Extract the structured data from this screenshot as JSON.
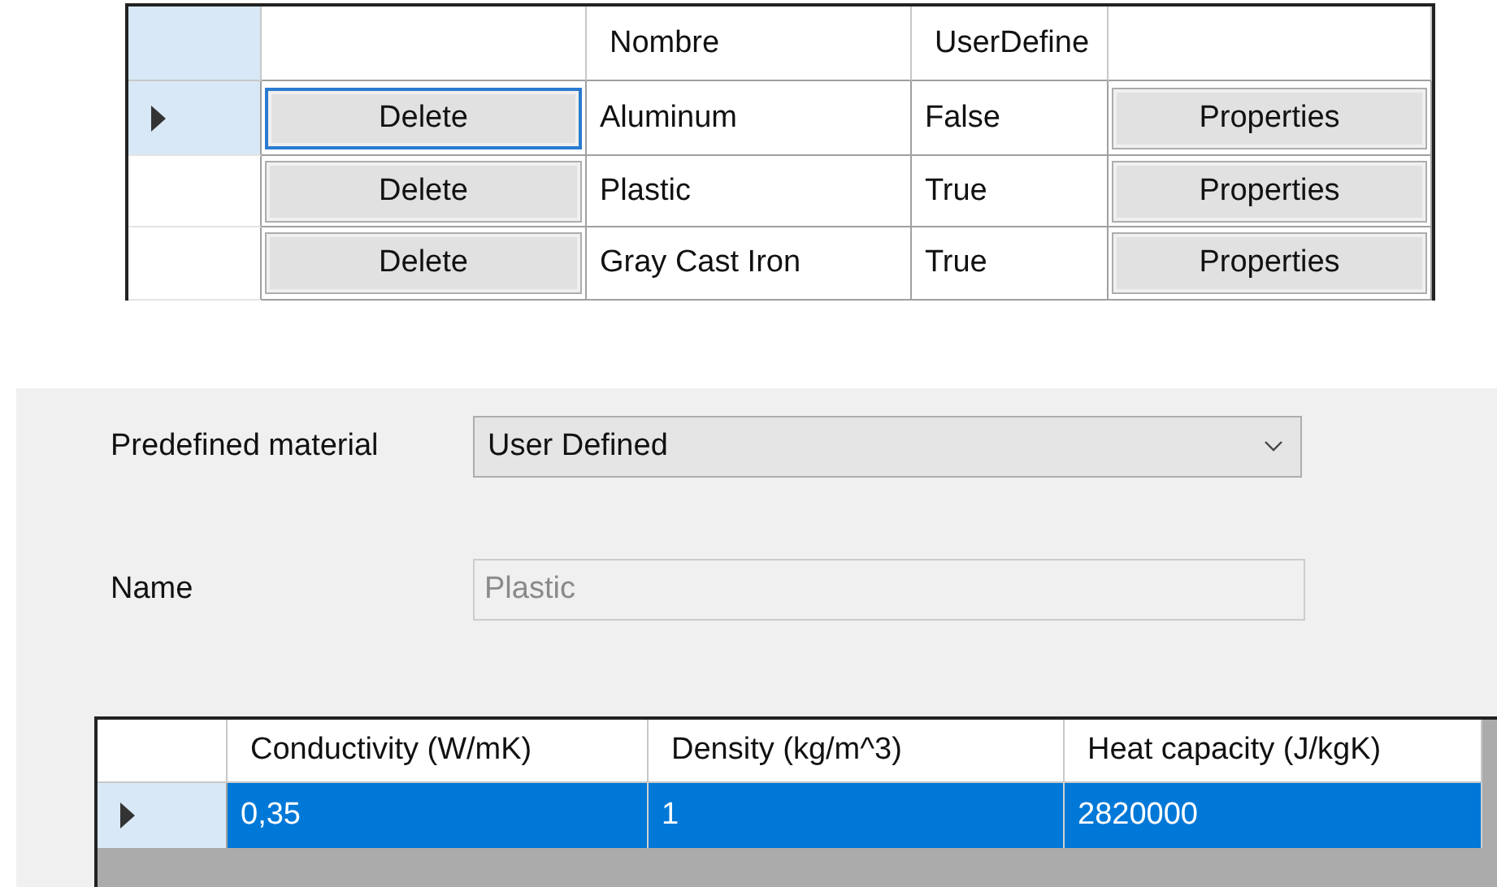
{
  "materials_grid": {
    "columns": [
      {
        "kind": "button"
      },
      {
        "kind": "text",
        "header": "Nombre"
      },
      {
        "kind": "text",
        "header": "UserDefine"
      },
      {
        "kind": "button"
      }
    ],
    "rows": [
      {
        "selected": true,
        "cells": [
          "Delete",
          "Aluminum",
          "False",
          "Properties"
        ]
      },
      {
        "selected": false,
        "cells": [
          "Delete",
          "Plastic",
          "True",
          "Properties"
        ]
      },
      {
        "selected": false,
        "cells": [
          "Delete",
          "Gray Cast Iron",
          "True",
          "Properties"
        ]
      }
    ]
  },
  "material_form": {
    "predefined_material": {
      "label": "Predefined material",
      "value": "User Defined"
    },
    "name": {
      "label": "Name",
      "value": "Plastic",
      "disabled": true
    },
    "properties_grid": {
      "columns": [
        "Conductivity (W/mK)",
        "Density (kg/m^3)",
        "Heat capacity (J/kgK)"
      ],
      "rows": [
        {
          "selected": true,
          "cells": [
            "0,35",
            "1",
            "2820000"
          ]
        }
      ]
    }
  }
}
